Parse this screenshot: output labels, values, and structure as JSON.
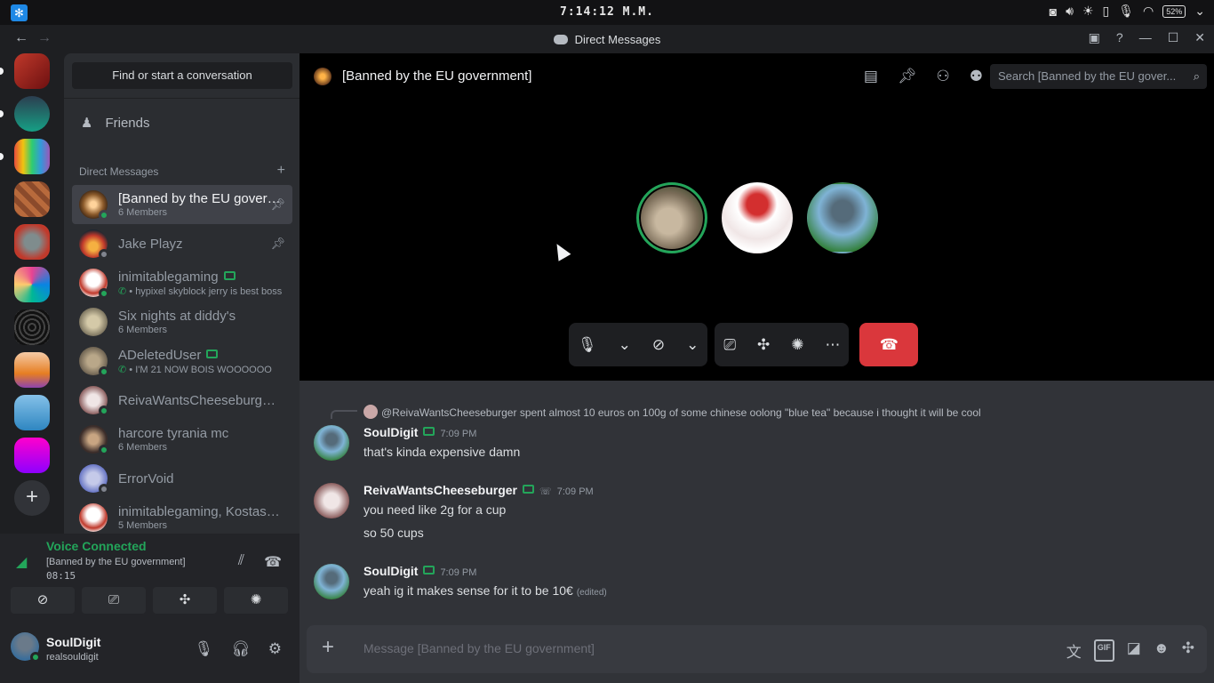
{
  "system": {
    "clock": "7:14:12 M.M.",
    "battery": "52%"
  },
  "window": {
    "title": "Direct Messages"
  },
  "sidebar": {
    "find_label": "Find or start a conversation",
    "friends_label": "Friends",
    "dm_header": "Direct Messages",
    "dms": [
      {
        "name": "[Banned by the EU government]",
        "sub": "6 Members",
        "pinned": true
      },
      {
        "name": "Jake Playz",
        "sub": "",
        "pinned": true
      },
      {
        "name": "inimitablegaming",
        "sub": "hypixel skyblock jerry is best boss"
      },
      {
        "name": "Six nights at diddy's",
        "sub": "6 Members"
      },
      {
        "name": "ADeletedUser",
        "sub": "I'M 21 NOW BOIS WOOOOOO"
      },
      {
        "name": "ReivaWantsCheeseburger",
        "sub": ""
      },
      {
        "name": "harcore tyrania mc",
        "sub": "6 Members"
      },
      {
        "name": "ErrorVoid",
        "sub": ""
      },
      {
        "name": "inimitablegaming, Kostas, …",
        "sub": "5 Members"
      }
    ]
  },
  "voice": {
    "status": "Voice Connected",
    "channel": "[Banned by the EU government]",
    "elapsed": "08:15"
  },
  "user": {
    "name": "SoulDigit",
    "tag": "realsouldigit"
  },
  "channel": {
    "name": "[Banned by the EU government]",
    "search_placeholder": "Search [Banned by the EU gover..."
  },
  "messages": {
    "reply_user": "@ReivaWantsCheeseburger",
    "reply_text": "spent almost 10 euros on 100g of some chinese oolong \"blue tea\" because i thought it will be cool",
    "groups": [
      {
        "author": "SoulDigit",
        "time": "7:09 PM",
        "lines": [
          "that's kinda expensive damn"
        ]
      },
      {
        "author": "ReivaWantsCheeseburger",
        "time": "7:09 PM",
        "lines": [
          "you need like 2g for a cup",
          "so 50 cups"
        ]
      },
      {
        "author": "SoulDigit",
        "time": "7:09 PM",
        "lines": [
          "yeah ig it makes sense for it to be 10€"
        ],
        "edited": "(edited)"
      }
    ]
  },
  "composer": {
    "placeholder": "Message [Banned by the EU government]",
    "gif_label": "GIF"
  },
  "colors": {
    "accent_green": "#23a55a",
    "hangup_red": "#da373c",
    "background": "#313338"
  }
}
